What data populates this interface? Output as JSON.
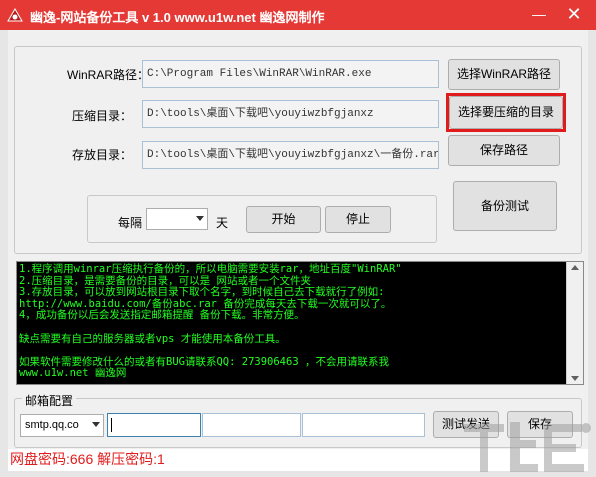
{
  "window": {
    "title": "幽逸-网站备份工具 v 1.0 www.u1w.net 幽逸网制作",
    "minimize_glyph": "—",
    "close_glyph": "✕"
  },
  "form": {
    "winrar_label": "WinRAR路径：",
    "winrar_path": "C:\\Program Files\\WinRAR\\WinRAR.exe",
    "compress_label": "压缩目录：",
    "compress_path": "D:\\tools\\桌面\\下载吧\\youyiwzbfgjanxz",
    "store_label": "存放目录：",
    "store_path": "D:\\tools\\桌面\\下载吧\\youyiwzbfgjanxz\\一备份.rar"
  },
  "buttons": {
    "select_winrar": "选择WinRAR路径",
    "select_compress": "选择要压缩的目录",
    "save_path": "保存路径",
    "backup_test": "备份测试",
    "start": "开始",
    "stop": "停止",
    "test_mail": "测试发送",
    "save_mail": "保存"
  },
  "schedule": {
    "every_label": "每隔",
    "interval_value": "",
    "unit_label": "天"
  },
  "console": {
    "lines": [
      "1.程序调用winrar压缩执行备份的，所以电脑需要安装rar，地址百度\"WinRAR\"",
      "2.压缩目录，是需要备份的目录，可以是 网站或者一个文件夹",
      "3.存放目录，可以放到网站根目录下取个名字，到时候自己去下载就行了例如:",
      "http://www.baidu.com/备份abc.rar 备份完成每天去下载一次就可以了。",
      "4，成功备份以后会发送指定邮箱提醒 备份下载。非常方便。",
      "",
      "  缺点需要有自己的服务器或者vps 才能使用本备份工具。",
      "",
      "如果软件需要修改什么的或者有BUG请联系QQ: 273906463 ，不会用请联系我",
      "www.u1w.net  幽逸网"
    ]
  },
  "mail": {
    "legend": "邮箱配置",
    "smtp_selected": "smtp.qq.co"
  },
  "status": {
    "text": "网盘密码:666 解压密码:1"
  },
  "colors": {
    "titlebar": "#e53935",
    "console_bg": "#000000",
    "console_text": "#22ff22",
    "highlight": "#e11b1b",
    "status_text": "#e11b1b"
  }
}
